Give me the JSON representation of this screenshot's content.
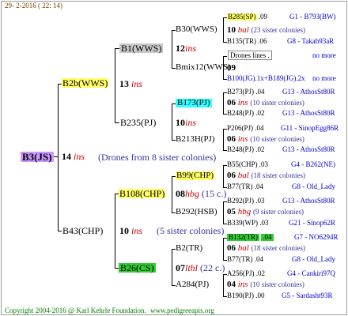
{
  "header": {
    "date": "29-  2-2016 ( 22: 14)"
  },
  "footer": {
    "copyright": "Copyright 2004-2016 @ Karl Kehrle Foundation.",
    "site": "www.pedigreeapis.org"
  },
  "root": {
    "name": "B3(JS)",
    "year": "14",
    "ins": "ins",
    "note": "(Drones from 8 sister colonies)"
  },
  "gen1": [
    {
      "name": "B2b(WWS)",
      "year": "13",
      "ins": "ins"
    },
    {
      "name": "B43(CHP)",
      "year": "10",
      "ins": "ins",
      "note": "(5 sister colonies)"
    }
  ],
  "gen2": [
    {
      "name": "B1(WWS)",
      "year": "12",
      "ins": "ins"
    },
    {
      "name": "B235(PJ)",
      "year": "10",
      "ins": "ins"
    },
    {
      "name": "B108(CHP)",
      "year": "08",
      "ins": "hbg",
      "note": "(15 c.)"
    },
    {
      "name": "B26(CS)",
      "year": "07",
      "ins": "lthl",
      "note": "(22 c.)"
    }
  ],
  "gen3": [
    {
      "name": "B30(WWS)",
      "year": "10",
      "ins": "bal",
      "note": "(23 sister colonies)"
    },
    {
      "name": "Bmix12(WWS)",
      "year": "09",
      "drones": "Drones lines .",
      "more": "no more"
    },
    {
      "name": "B173(PJ)",
      "year": "06",
      "ins": "ins",
      "note": "(10 sister colonies)"
    },
    {
      "name": "B213H(PJ)",
      "year": "06",
      "ins": "ins",
      "note": "(10 sister colonies)"
    },
    {
      "name": "B99(CHP)",
      "year": "06",
      "ins": "bal",
      "note": "(18 sister colonies)"
    },
    {
      "name": "B292(HSB)",
      "year": "05",
      "ins": "hbg",
      "note": "(9 sister colonies)"
    },
    {
      "name": "B2(TR)",
      "year": "06",
      "ins": "bal",
      "note": "(18 sister colonies)"
    },
    {
      "name": "A284(PJ)",
      "year": "04",
      "ins": "ins",
      "note": "(10 sister colonies)"
    }
  ],
  "gen4": [
    {
      "name": "B285(SP)",
      "yr": ".09",
      "line": "G1 - B793(BW)"
    },
    {
      "name": "B135(TR)",
      "yr": ".06",
      "line": "G8 - Takab93aR"
    },
    {
      "name": "B100(JG).1x+B189(JG).2x",
      "yr": "",
      "line": "no more"
    },
    {
      "name": "B273(PJ)",
      "yr": ".04",
      "line": "G13 - AthosSt80R"
    },
    {
      "name": "B248(PJ)",
      "yr": ".02",
      "line": "G13 - AthosSt80R"
    },
    {
      "name": "P206(PJ)",
      "yr": ".04",
      "line": "G11 - SinopEgg86R"
    },
    {
      "name": "B248(PJ)",
      "yr": ".02",
      "line": "G13 - AthosSt80R"
    },
    {
      "name": "B55(CHP)",
      "yr": ".03",
      "line": "G4 - B262(NE)"
    },
    {
      "name": "B77(TR)",
      "yr": ".04",
      "line": "G8 - Old_Lady"
    },
    {
      "name": "B292(PJ)",
      "yr": ".03",
      "line": "G13 - AthosSt80R"
    },
    {
      "name": "B339(WP)",
      "yr": ".03",
      "line": "G21 - Sinop62R"
    },
    {
      "name": "B132(TR)",
      "yr": ".04",
      "line": "G7 - NO6294R"
    },
    {
      "name": "B77(TR)",
      "yr": ".04",
      "line": "G8 - Old_Lady"
    },
    {
      "name": "A256(PJ)",
      "yr": ".02",
      "line": "G4 - Cankiri97Q"
    },
    {
      "name": "B190(PJ)",
      "yr": ".00",
      "line": "G5 - Sardasht93R"
    }
  ],
  "colors": {
    "yellow": "#ffff66",
    "violet": "#cc99ff",
    "gray": "#c8c8c8",
    "cyan": "#33ffff",
    "green": "#33cc33",
    "blue": "#0000cc",
    "red": "#cc0000"
  }
}
